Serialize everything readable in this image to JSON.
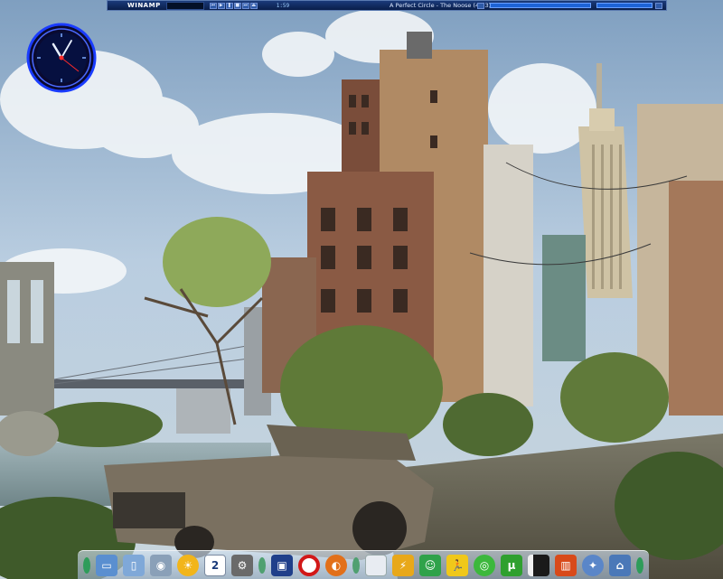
{
  "winamp": {
    "logo": "WINAMP",
    "time": "1:59",
    "track_title": "A Perfect Circle - The Noose (4:33)"
  },
  "dock": {
    "items": [
      {
        "icon": "green-orb-icon",
        "color": "#2e9c5a"
      },
      {
        "icon": "monitor-icon",
        "color": "#5a8fd0"
      },
      {
        "icon": "folder-icon",
        "color": "#7fa8d8"
      },
      {
        "icon": "burn-disc-icon",
        "color": "#8aa0b8"
      },
      {
        "icon": "sun-icon",
        "color": "#f2b51a"
      },
      {
        "icon": "calendar-icon",
        "color": "#ffffff",
        "label": "2"
      },
      {
        "icon": "gear-icon",
        "color": "#6a6a6a"
      },
      {
        "icon": "small-orb-icon",
        "color": "#4fa070"
      },
      {
        "icon": "media-player-icon",
        "color": "#1f3f8a"
      },
      {
        "icon": "opera-icon",
        "color": "#d21818"
      },
      {
        "icon": "firefox-icon",
        "color": "#e2701a"
      },
      {
        "icon": "small-orb-icon",
        "color": "#4fa070"
      },
      {
        "icon": "document-icon",
        "color": "#e8ecf2"
      },
      {
        "icon": "winamp-icon",
        "color": "#e8a81a"
      },
      {
        "icon": "msn-messenger-icon",
        "color": "#2fa24a"
      },
      {
        "icon": "running-man-icon",
        "color": "#f0c81a"
      },
      {
        "icon": "green-disc-icon",
        "color": "#3cb83c"
      },
      {
        "icon": "utorrent-icon",
        "color": "#2fa02f",
        "label": "µ"
      },
      {
        "icon": "notebook-icon",
        "color": "#1a1a1a"
      },
      {
        "icon": "books-icon",
        "color": "#d84a1a"
      },
      {
        "icon": "settings-icon",
        "color": "#5a86c8"
      },
      {
        "icon": "network-icon",
        "color": "#4a78b8"
      },
      {
        "icon": "green-orb-icon",
        "color": "#2e9c5a"
      }
    ]
  },
  "colors": {
    "winamp_bg": "#0a1e4a",
    "clock_ring": "#1a3cff",
    "sky": "#a9c3d9"
  }
}
